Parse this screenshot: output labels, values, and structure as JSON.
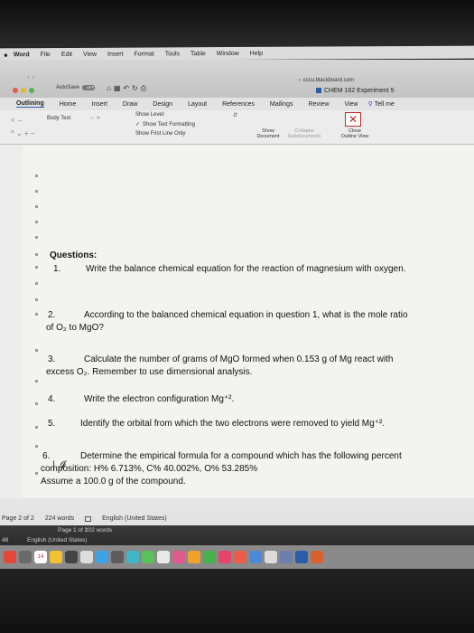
{
  "menubar": {
    "app": "Word",
    "items": [
      "File",
      "Edit",
      "View",
      "Insert",
      "Format",
      "Tools",
      "Table",
      "Window",
      "Help"
    ]
  },
  "window": {
    "url": "ccsu.blackboard.com",
    "title": "CHEM 162 Experiment 5",
    "autosave_label": "AutoSave",
    "autosave_state": "OFF"
  },
  "ribbon": {
    "tabs": [
      "Outlining",
      "Home",
      "Insert",
      "Draw",
      "Design",
      "Layout",
      "References",
      "Mailings",
      "Review",
      "View"
    ],
    "tell_me": "Tell me",
    "style": "Body Text",
    "show_level": "Show Level:",
    "show_text_formatting": "Show Text Formatting",
    "show_first_line": "Show First Line Only",
    "show_document": "Show\nDocument",
    "collapse_subdocs": "Collapse\nSubdocuments",
    "close_outline": "Close\nOutline View"
  },
  "document": {
    "heading": "Questions:",
    "q1_num": "1.",
    "q1_text": "Write the balance chemical equation for the reaction of magnesium with oxygen.",
    "q2_num": "2.",
    "q2_line1": "According to the balanced chemical equation in question 1, what is the mole ratio",
    "q2_line2": "of O₂ to MgO?",
    "q3_num": "3.",
    "q3_line1": "Calculate the number of grams of MgO formed when 0.153 g of Mg react with",
    "q3_line2": "excess O₂. Remember to use dimensional analysis.",
    "q4_num": "4.",
    "q4_text": "Write the electron configuration Mg⁺².",
    "q5_num": "5.",
    "q5_text": "Identify the orbital from which the two electrons were removed to yield Mg⁺².",
    "q6_num": "6.",
    "q6_line1": "Determine the empirical formula for a compound which has the following percent",
    "q6_line2": "composition: H% 6.713%, C% 40.002%, O% 53.285%",
    "q6_line3": "Assume a 100.0 g of the compound."
  },
  "status": {
    "page": "Page 2 of 2",
    "words": "224 words",
    "language": "English (United States)"
  },
  "status2": {
    "page": "Page 1 of 2",
    "words": "102 words",
    "language": "English (United States)",
    "clock_fragment": "48"
  },
  "dock": {
    "calendar_day": "14"
  },
  "colors": {
    "accent": "#2a5caa",
    "close_red": "#c02a2a"
  }
}
